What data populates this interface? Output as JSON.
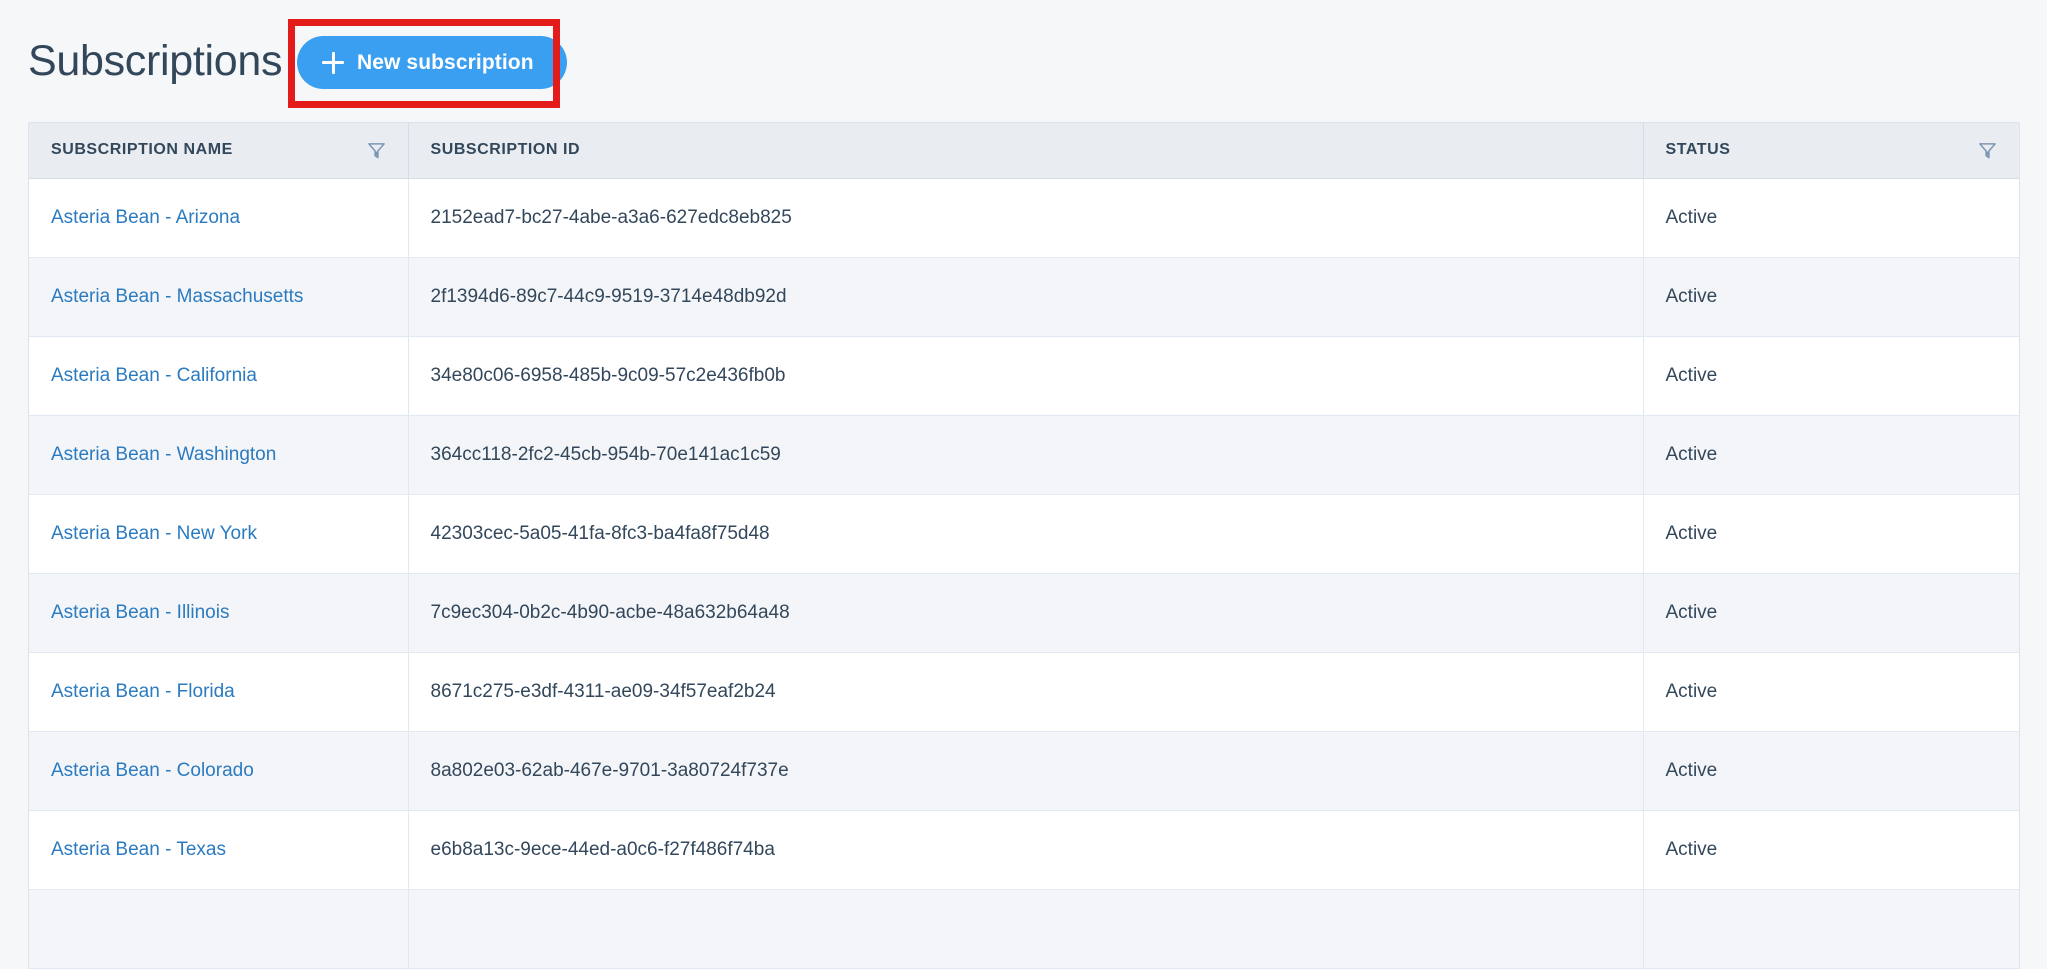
{
  "header": {
    "title": "Subscriptions",
    "new_button_label": "New subscription",
    "plus_icon": "plus-icon",
    "accent_color": "#3A9FF0",
    "annotation_color": "#E31B1B",
    "title_color": "#33475B"
  },
  "table": {
    "columns": [
      {
        "label": "SUBSCRIPTION NAME",
        "filter_icon": "filter-funnel-icon",
        "has_filter": true
      },
      {
        "label": "SUBSCRIPTION ID",
        "filter_icon": "",
        "has_filter": false
      },
      {
        "label": "STATUS",
        "filter_icon": "filter-funnel-icon",
        "has_filter": true
      }
    ],
    "link_color": "#2B7BC0",
    "rows": [
      {
        "name": "Asteria Bean - Arizona",
        "id": "2152ead7-bc27-4abe-a3a6-627edc8eb825",
        "status": "Active"
      },
      {
        "name": "Asteria Bean - Massachusetts",
        "id": "2f1394d6-89c7-44c9-9519-3714e48db92d",
        "status": "Active"
      },
      {
        "name": "Asteria Bean - California",
        "id": "34e80c06-6958-485b-9c09-57c2e436fb0b",
        "status": "Active"
      },
      {
        "name": "Asteria Bean - Washington",
        "id": "364cc118-2fc2-45cb-954b-70e141ac1c59",
        "status": "Active"
      },
      {
        "name": "Asteria Bean - New York",
        "id": "42303cec-5a05-41fa-8fc3-ba4fa8f75d48",
        "status": "Active"
      },
      {
        "name": "Asteria Bean - Illinois",
        "id": "7c9ec304-0b2c-4b90-acbe-48a632b64a48",
        "status": "Active"
      },
      {
        "name": "Asteria Bean - Florida",
        "id": "8671c275-e3df-4311-ae09-34f57eaf2b24",
        "status": "Active"
      },
      {
        "name": "Asteria Bean - Colorado",
        "id": "8a802e03-62ab-467e-9701-3a80724f737e",
        "status": "Active"
      },
      {
        "name": "Asteria Bean - Texas",
        "id": "e6b8a13c-9ece-44ed-a0c6-f27f486f74ba",
        "status": "Active"
      },
      {
        "name": "",
        "id": "",
        "status": ""
      }
    ]
  }
}
